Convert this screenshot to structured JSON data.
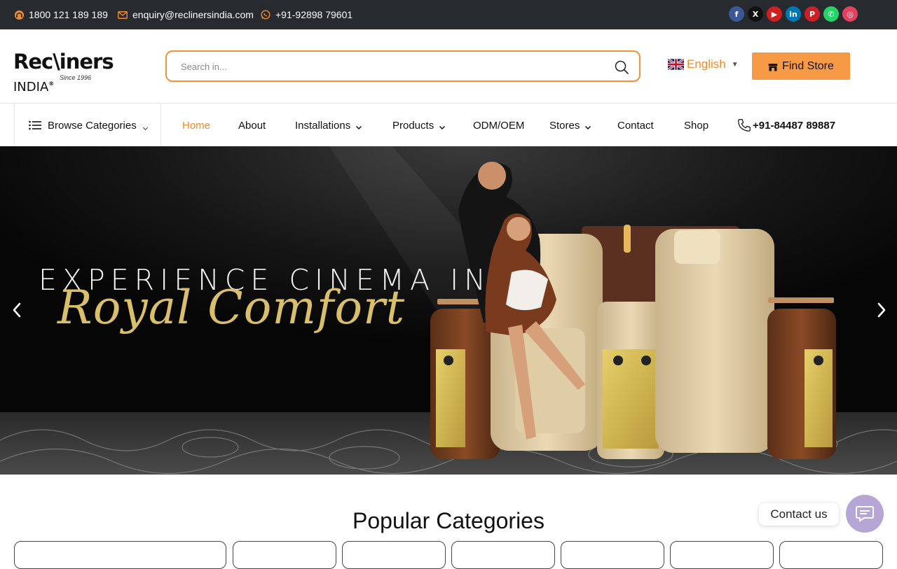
{
  "topbar": {
    "phone": "1800 121 189 189",
    "email": "enquiry@reclinersindia.com",
    "whatsapp": "+91-92898 79601",
    "socials": [
      {
        "name": "facebook-icon",
        "glyph": "f",
        "color": "#3b5998"
      },
      {
        "name": "x-icon",
        "glyph": "X",
        "color": "#111111"
      },
      {
        "name": "youtube-icon",
        "glyph": "▶",
        "color": "#cd201f"
      },
      {
        "name": "linkedin-icon",
        "glyph": "in",
        "color": "#0077b5"
      },
      {
        "name": "pinterest-icon",
        "glyph": "P",
        "color": "#cb2027"
      },
      {
        "name": "whatsapp-icon",
        "glyph": "✆",
        "color": "#25d366"
      },
      {
        "name": "instagram-icon",
        "glyph": "◎",
        "color": "#e4405f"
      }
    ]
  },
  "header": {
    "logo_main": "Rec\\iners",
    "logo_country": "INDIA",
    "logo_reg": "®",
    "logo_since": "Since 1996",
    "search_placeholder": "Search in...",
    "language": "English",
    "find_store_label": "Find  Store",
    "accent_color": "#f79a45"
  },
  "nav": {
    "browse_label": "Browse Categories",
    "items": [
      {
        "label": "Home",
        "active": true
      },
      {
        "label": "About"
      },
      {
        "label": "Installations",
        "dropdown": true
      },
      {
        "label": "Products",
        "dropdown": true
      },
      {
        "label": "ODM/OEM"
      },
      {
        "label": "Stores",
        "dropdown": true
      },
      {
        "label": "Contact"
      },
      {
        "label": "Shop"
      }
    ],
    "phone": "+91-84487 89887"
  },
  "hero": {
    "title": "EXPERIENCE CINEMA IN",
    "script": "Royal Comfort"
  },
  "popular": {
    "title": "Popular Categories"
  },
  "contact_widget": {
    "label": "Contact us"
  }
}
